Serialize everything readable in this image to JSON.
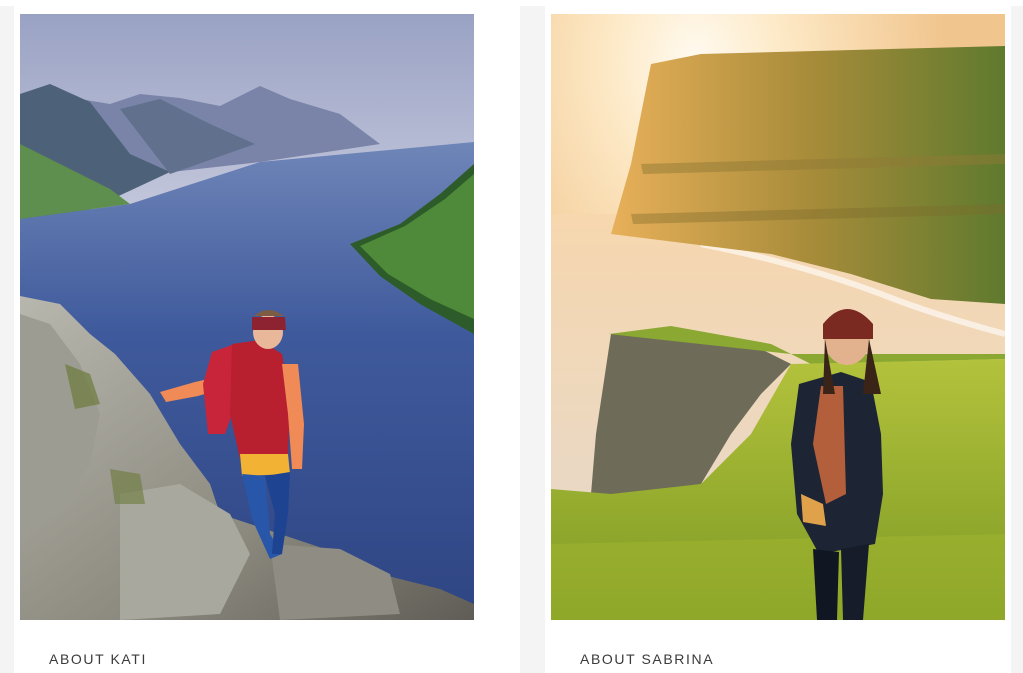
{
  "cards": [
    {
      "caption": "ABOUT KATI",
      "image": "hiker-on-rocky-ridge-above-fjord"
    },
    {
      "caption": "ABOUT SABRINA",
      "image": "woman-on-grassy-cliff-at-sunset"
    }
  ],
  "colors": {
    "page_background": "#f4f4f4",
    "card_background": "#ffffff",
    "caption_text": "#3a3a3a"
  }
}
